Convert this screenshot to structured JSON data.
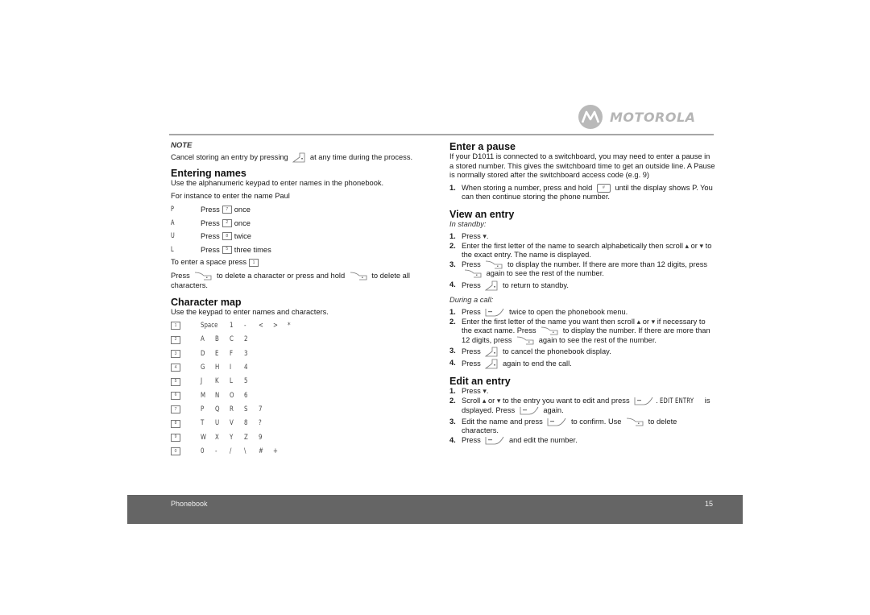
{
  "brand": {
    "name": "MOTOROLA",
    "logo_icon": "motorola-batwing-logo"
  },
  "left": {
    "note": {
      "label": "NOTE",
      "text_before": "Cancel storing an entry by pressing",
      "icon": "end-call-key",
      "text_after": "at any time during the process."
    },
    "entering_names": {
      "title": "Entering names",
      "intro": "Use the alphanumeric keypad to enter names in the phonebook.",
      "example": "For instance to enter the name Paul",
      "steps": [
        {
          "letter": "P",
          "press": "Press",
          "key": "7",
          "key_sub": "pqrs",
          "times": "once"
        },
        {
          "letter": "A",
          "press": "Press",
          "key": "2",
          "key_sub": "abc",
          "times": "once"
        },
        {
          "letter": "U",
          "press": "Press",
          "key": "8",
          "key_sub": "tuv",
          "times": "twice"
        },
        {
          "letter": "L",
          "press": "Press",
          "key": "5",
          "key_sub": "jkl",
          "times": "three times"
        }
      ],
      "space_text": "To enter a space press",
      "space_key": "1",
      "delete_text_1": "Press",
      "delete_text_2": "to delete a character or press and hold",
      "delete_text_3": "to delete all characters.",
      "delete_icon": "delete-softkey"
    },
    "character_map": {
      "title": "Character map",
      "intro": "Use the keypad to enter names and characters.",
      "rows": [
        {
          "key": "1",
          "key_sub": "—",
          "chars": [
            "Space",
            "1",
            "-",
            "<",
            ">",
            "*"
          ]
        },
        {
          "key": "2",
          "key_sub": "abc",
          "chars": [
            "A",
            "B",
            "C",
            "2"
          ]
        },
        {
          "key": "3",
          "key_sub": "def",
          "chars": [
            "D",
            "E",
            "F",
            "3"
          ]
        },
        {
          "key": "4",
          "key_sub": "ghi",
          "chars": [
            "G",
            "H",
            "I",
            "4"
          ]
        },
        {
          "key": "5",
          "key_sub": "jkl",
          "chars": [
            "J",
            "K",
            "L",
            "5"
          ]
        },
        {
          "key": "6",
          "key_sub": "mno",
          "chars": [
            "M",
            "N",
            "O",
            "6"
          ]
        },
        {
          "key": "7",
          "key_sub": "pqrs",
          "chars": [
            "P",
            "Q",
            "R",
            "S",
            "7"
          ]
        },
        {
          "key": "8",
          "key_sub": "tuv",
          "chars": [
            "T",
            "U",
            "V",
            "8",
            "?"
          ]
        },
        {
          "key": "9",
          "key_sub": "wxyz",
          "chars": [
            "W",
            "X",
            "Y",
            "Z",
            "9"
          ]
        },
        {
          "key": "0",
          "key_sub": "",
          "chars": [
            "0",
            "-",
            "/",
            "\\",
            "#",
            "+"
          ]
        }
      ]
    }
  },
  "right": {
    "pause": {
      "title": "Enter a pause",
      "body": "If your D1011 is connected to a switchboard, you may need to enter a pause in a stored number. This gives the switchboard time to get an outside line. A Pause is normally stored after the switchboard access code (e.g. 9)",
      "step1_before": "When storing a number, press and hold",
      "step1_key": "#",
      "step1_after": "until the display shows P. You can then continue storing the phone number."
    },
    "view": {
      "title": "View an entry",
      "standby_label": "In standby:",
      "standby_steps": {
        "s1": "Press",
        "s2a": "Enter the first letter of the name to search alphabetically then scroll",
        "s2b": "or",
        "s2c": "to the exact entry. The name is displayed.",
        "s3a": "Press",
        "s3b": "to display the number. If there are more than 12 digits,",
        "s3c": "press",
        "s3d": "again to see the rest of the number.",
        "s4a": "Press",
        "s4b": "to return to standby."
      },
      "call_label": "During a call:",
      "call_steps": {
        "c1a": "Press",
        "c1b": "twice to open the phonebook menu.",
        "c2a": "Enter the first letter of the name you want then scroll",
        "c2b": "or",
        "c2c": "if necessary to the exact name. Press",
        "c2d": "to display the number. If there are more than 12 digits, press",
        "c2e": "again to see the rest of the number.",
        "c3a": "Press",
        "c3b": "to cancel the phonebook display.",
        "c4a": "Press",
        "c4b": "again to end the call."
      }
    },
    "edit": {
      "title": "Edit an entry",
      "e1": "Press",
      "e2a": "Scroll",
      "e2b": "or",
      "e2c": "to the entry you want to edit and press",
      "e2d": "EDIT ENTRY",
      "e2e": "is dsplayed. Press",
      "e2f": "again.",
      "e3a": "Edit the name and press",
      "e3b": "to confirm. Use",
      "e3c": "to delete characters.",
      "e4a": "Press",
      "e4b": "and edit the number."
    }
  },
  "footer": {
    "section": "Phonebook",
    "page": "15"
  },
  "nums": [
    "1.",
    "2.",
    "3.",
    "4."
  ]
}
